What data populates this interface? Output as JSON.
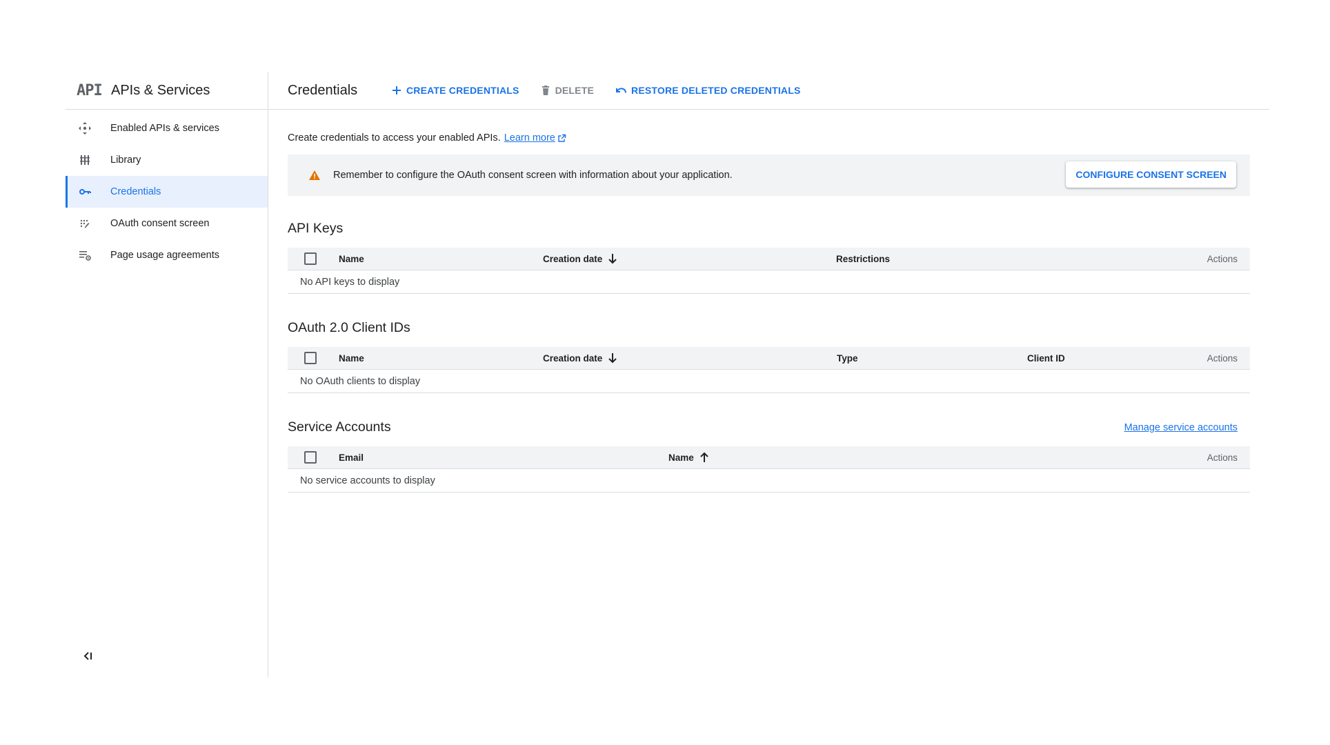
{
  "sidebar": {
    "logo": "API",
    "title": "APIs & Services",
    "items": [
      {
        "label": "Enabled APIs & services",
        "icon": "enabled-apis-icon"
      },
      {
        "label": "Library",
        "icon": "library-icon"
      },
      {
        "label": "Credentials",
        "icon": "key-icon",
        "active": true
      },
      {
        "label": "OAuth consent screen",
        "icon": "consent-icon"
      },
      {
        "label": "Page usage agreements",
        "icon": "settings-list-icon"
      }
    ],
    "collapse_icon": "collapse-icon"
  },
  "topbar": {
    "title": "Credentials",
    "create_label": "CREATE CREDENTIALS",
    "delete_label": "DELETE",
    "restore_label": "RESTORE DELETED CREDENTIALS"
  },
  "intro": {
    "text": "Create credentials to access your enabled APIs.",
    "link": "Learn more"
  },
  "banner": {
    "message": "Remember to configure the OAuth consent screen with information about your application.",
    "button": "CONFIGURE CONSENT SCREEN"
  },
  "api_keys": {
    "title": "API Keys",
    "columns": {
      "name": "Name",
      "creation_date": "Creation date",
      "restrictions": "Restrictions",
      "actions": "Actions"
    },
    "empty": "No API keys to display"
  },
  "oauth": {
    "title": "OAuth 2.0 Client IDs",
    "columns": {
      "name": "Name",
      "creation_date": "Creation date",
      "type": "Type",
      "client_id": "Client ID",
      "actions": "Actions"
    },
    "empty": "No OAuth clients to display"
  },
  "service_accounts": {
    "title": "Service Accounts",
    "manage_link": "Manage service accounts",
    "columns": {
      "email": "Email",
      "name": "Name",
      "actions": "Actions"
    },
    "empty": "No service accounts to display"
  },
  "colors": {
    "accent": "#1a73e8",
    "warning": "#e37400",
    "muted": "#5f6368"
  }
}
